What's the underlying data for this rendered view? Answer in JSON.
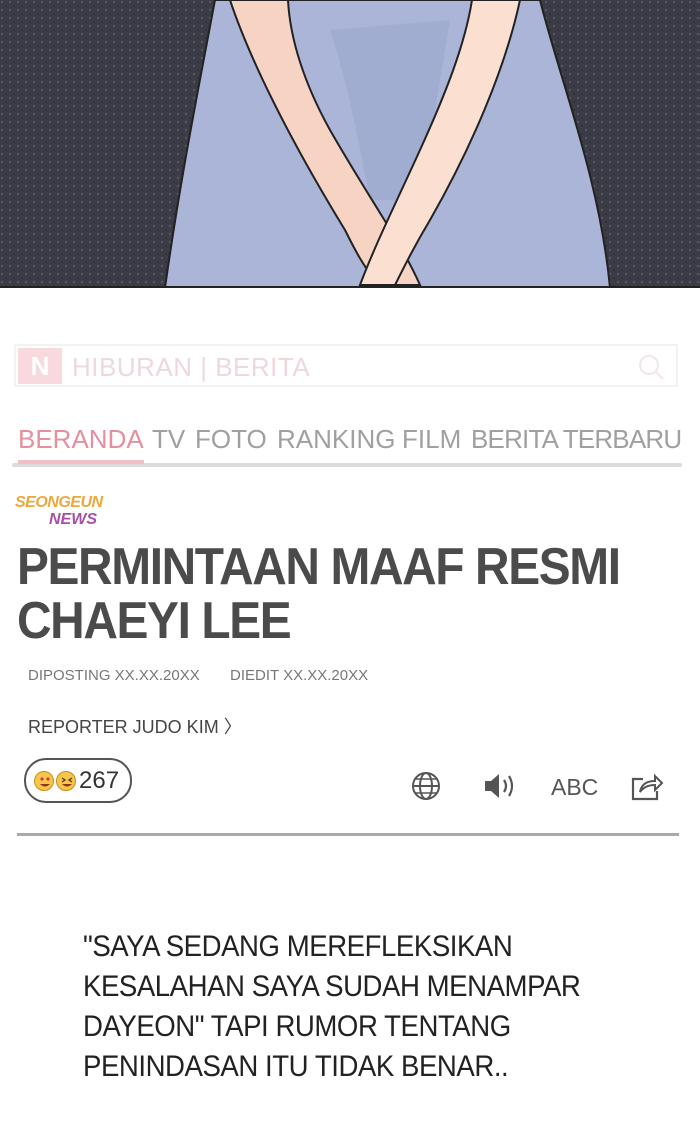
{
  "header": {
    "logo_letter": "N",
    "site_title": "HIBURAN | BERITA",
    "search_icon": "search-icon"
  },
  "nav": {
    "items": [
      "BERANDA",
      "TV",
      "FOTO",
      "RANKING",
      "FILM",
      "BERITA TERBARU"
    ],
    "active_index": 0
  },
  "article": {
    "brand_line1": "SEONGEUN",
    "brand_line2": "NEWS",
    "headline_line1": "PERMINTAAN MAAF RESMI",
    "headline_line2": "CHAEYI LEE",
    "posted": "DIPOSTING XX.XX.20XX",
    "edited": "DIEDIT XX.XX.20XX",
    "reporter": "REPORTER JUDO KIM 〉",
    "reaction_count": "267",
    "tools": [
      "globe-icon",
      "speaker-icon",
      "ABC",
      "share-icon"
    ]
  },
  "quote": {
    "line1": "\"SAYA SEDANG MEREFLEKSIKAN",
    "line2": "KESALAHAN SAYA SUDAH MENAMPAR",
    "line3": "DAYEON\" TAPI RUMOR TENTANG",
    "line4": "PENINDASAN ITU TIDAK BENAR.."
  },
  "colors": {
    "accent_pink": "#e6909f",
    "headline": "#4b4b4b",
    "brand_orange": "#e9a93c",
    "brand_purple": "#a64fa5"
  }
}
